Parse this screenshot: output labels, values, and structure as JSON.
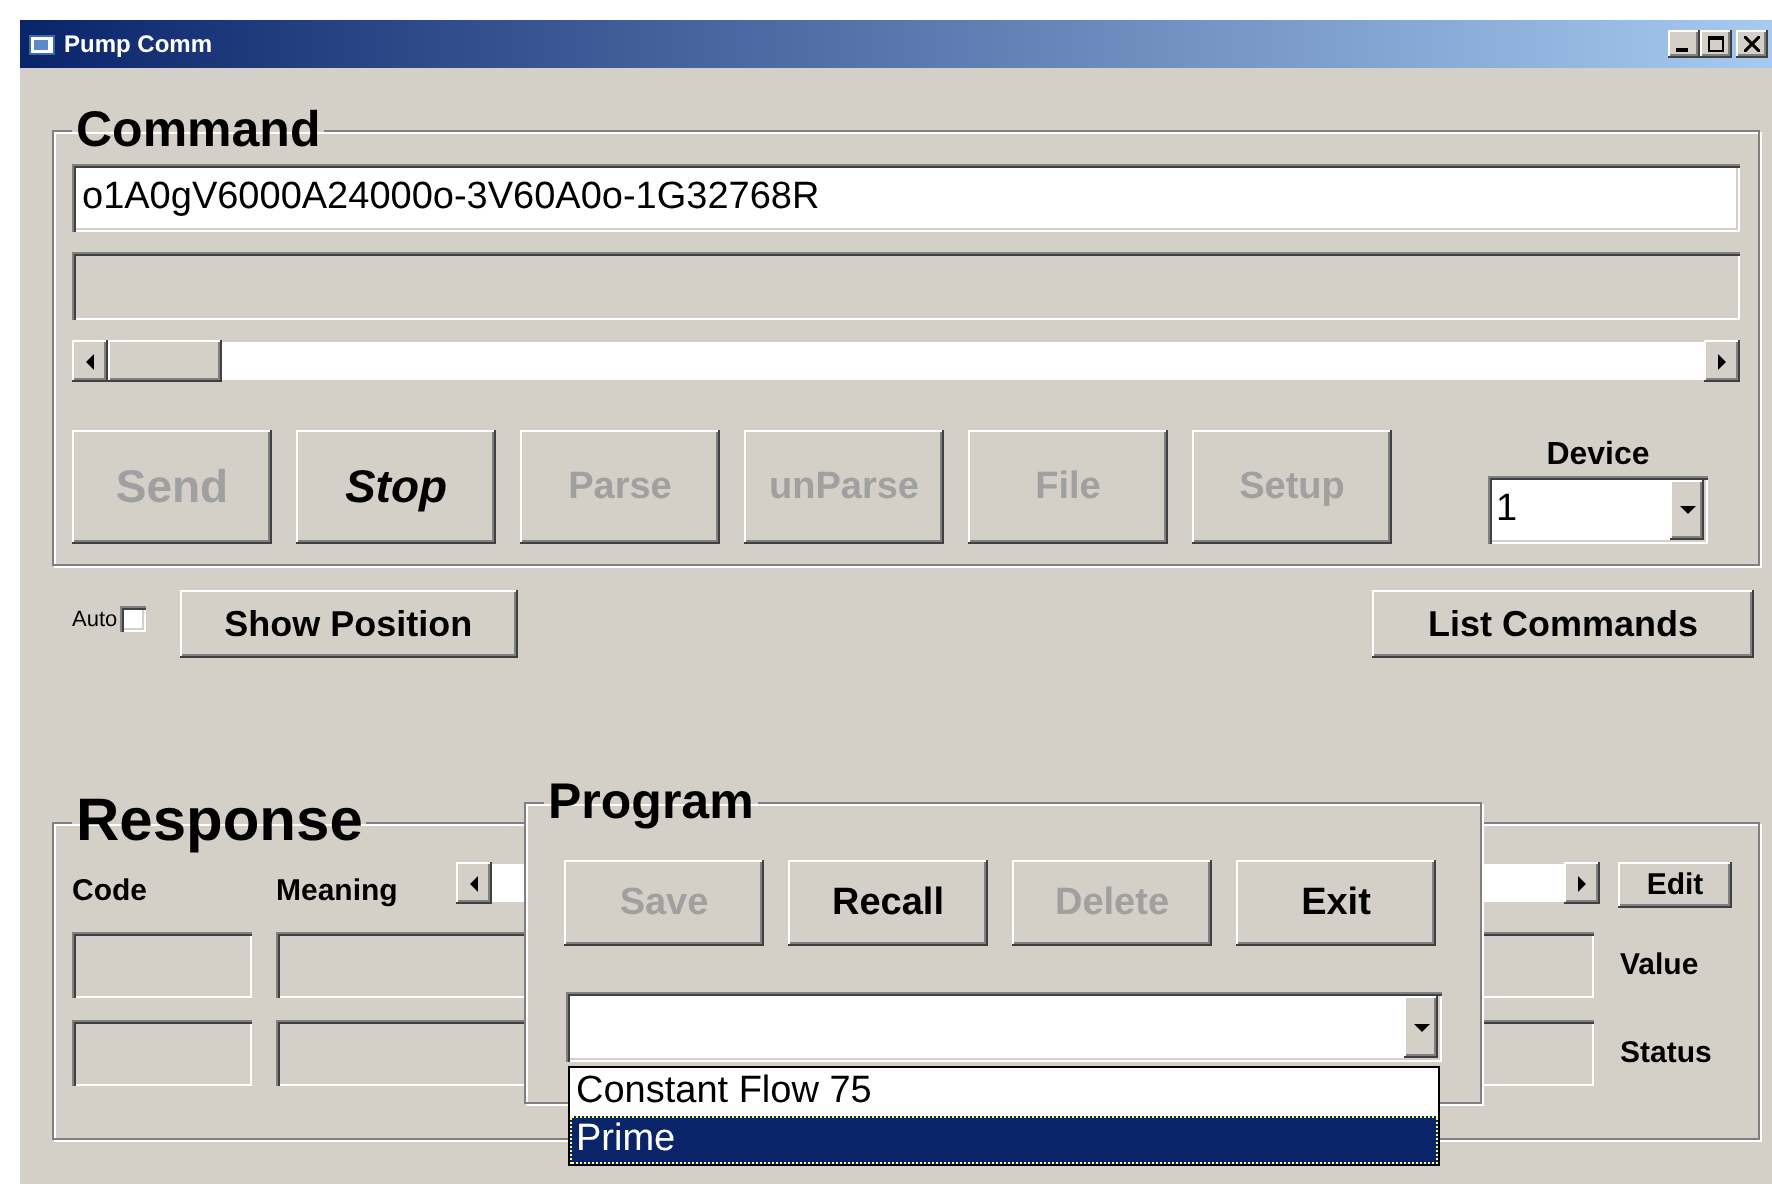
{
  "window": {
    "title": "Pump Comm"
  },
  "command": {
    "title": "Command",
    "value": "o1A0gV6000A24000o-3V60A0o-1G32768R",
    "buttons": [
      {
        "label": "Send",
        "kind": "large",
        "disabled": true
      },
      {
        "label": "Stop",
        "kind": "large-italic",
        "disabled": false
      },
      {
        "label": "Parse",
        "kind": "plain",
        "disabled": true
      },
      {
        "label": "unParse",
        "kind": "plain",
        "disabled": true
      },
      {
        "label": "File",
        "kind": "plain",
        "disabled": true
      },
      {
        "label": "Setup",
        "kind": "plain",
        "disabled": true
      }
    ],
    "device": {
      "label": "Device",
      "value": "1"
    }
  },
  "auto": {
    "label": "Auto",
    "checked": false
  },
  "show_position_button": "Show Position",
  "list_commands_button": "List Commands",
  "response": {
    "title": "Response",
    "columns": [
      "Code",
      "Meaning"
    ],
    "edit_button": "Edit",
    "row_labels": [
      "Value",
      "Status"
    ]
  },
  "program": {
    "title": "Program",
    "buttons": [
      {
        "label": "Save",
        "disabled": true
      },
      {
        "label": "Recall",
        "disabled": false
      },
      {
        "label": "Delete",
        "disabled": true
      },
      {
        "label": "Exit",
        "disabled": false
      }
    ],
    "options": [
      {
        "label": "Constant Flow 75",
        "selected": false
      },
      {
        "label": "Prime",
        "selected": true
      }
    ]
  }
}
